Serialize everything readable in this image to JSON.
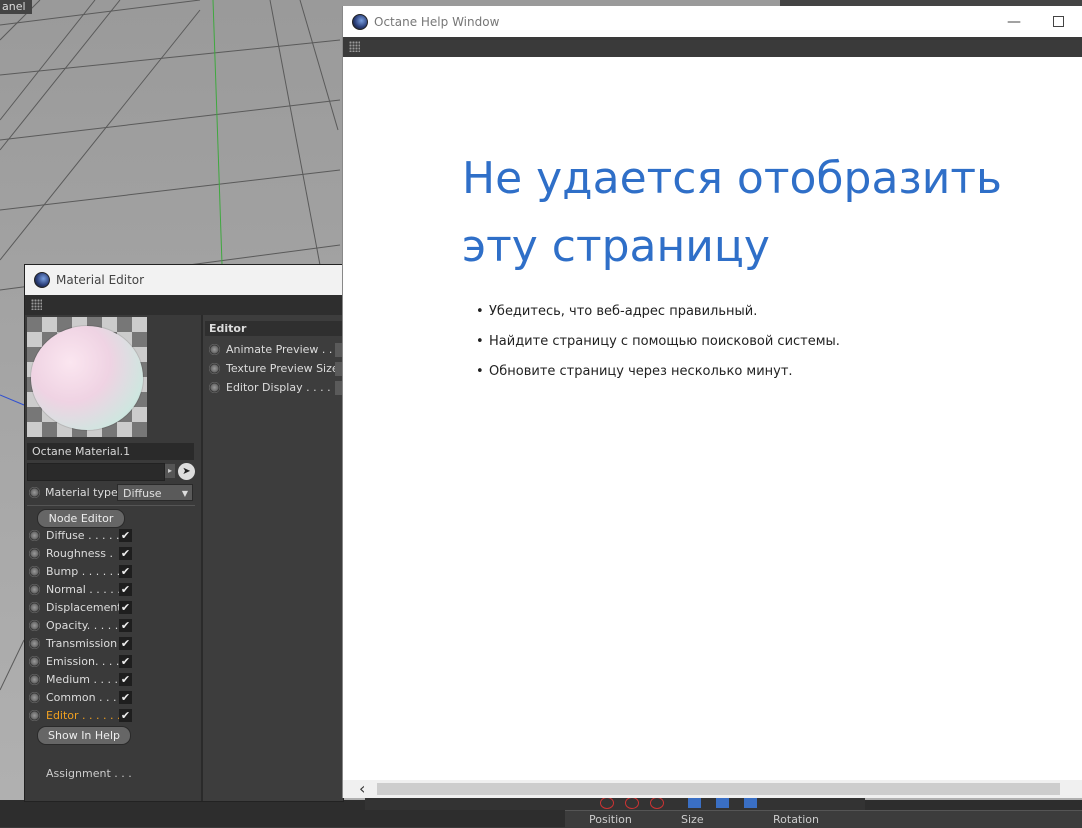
{
  "background": {
    "panel_tag": "anel",
    "coordinates_header": {
      "position": "Position",
      "size": "Size",
      "rotation": "Rotation"
    }
  },
  "material_editor": {
    "title": "Material Editor",
    "material_name": "Octane Material.1",
    "material_type_label": "Material type",
    "material_type_value": "Diffuse",
    "node_editor_button": "Node Editor",
    "channels": [
      {
        "label": "Diffuse . . . . .",
        "checked": "✔"
      },
      {
        "label": "Roughness  .",
        "checked": "✔"
      },
      {
        "label": "Bump  . . . . . .",
        "checked": "✔"
      },
      {
        "label": "Normal . . . . .",
        "checked": "✔"
      },
      {
        "label": "Displacement",
        "checked": "✔"
      },
      {
        "label": "Opacity. . . . .",
        "checked": "✔"
      },
      {
        "label": "Transmission",
        "checked": "✔"
      },
      {
        "label": "Emission. . . .",
        "checked": "✔"
      },
      {
        "label": "Medium . . . .",
        "checked": "✔"
      },
      {
        "label": "Common  . . .",
        "checked": "✔"
      },
      {
        "label": "Editor . . . . . .",
        "checked": "✔"
      }
    ],
    "active_channel": "Editor",
    "show_in_help_button": "Show In Help",
    "assignment_label": "Assignment . . .",
    "editor_panel": {
      "header": "Editor",
      "rows": [
        "Animate Preview . . .",
        "Texture Preview Size",
        "Editor Display  . . . . ."
      ]
    }
  },
  "help_window": {
    "title": "Octane Help Window",
    "error_heading": "Не удается отобразить эту страницу",
    "error_tips": [
      "Убедитесь, что веб-адрес правильный.",
      "Найдите страницу с помощью поисковой системы.",
      "Обновите страницу через несколько минут."
    ],
    "heading_color": "#2f6fc8"
  }
}
